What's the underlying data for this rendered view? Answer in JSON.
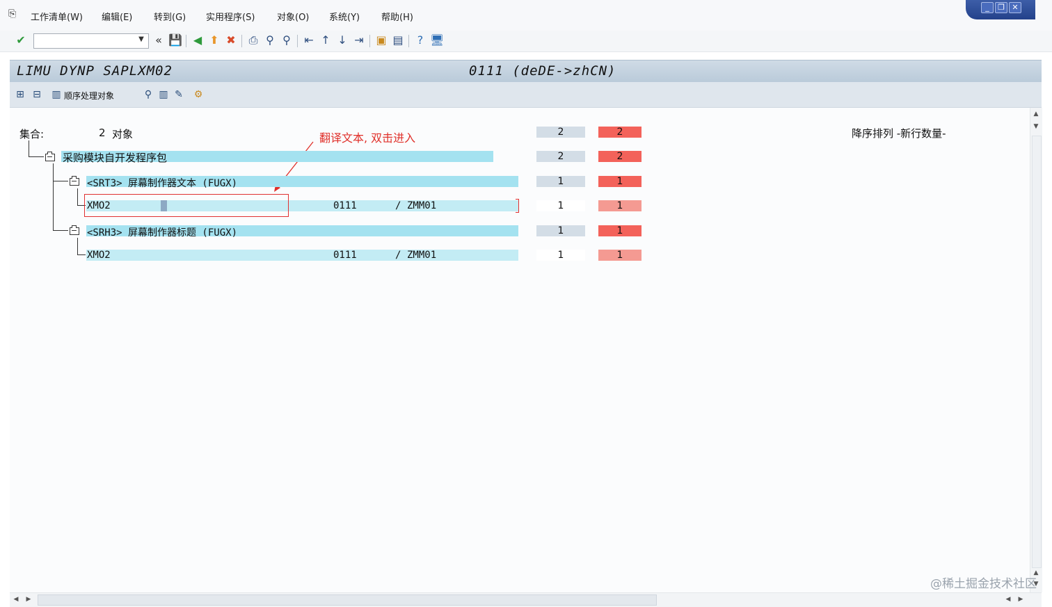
{
  "menu": {
    "items": [
      "工作清单(W)",
      "编辑(E)",
      "转到(G)",
      "实用程序(S)",
      "对象(O)",
      "系统(Y)",
      "帮助(H)"
    ]
  },
  "toolbar": {
    "command_value": "",
    "icons": [
      "enter-icon",
      "save-icon",
      "back-icon",
      "exit-icon",
      "cancel-icon",
      "print-icon",
      "find-icon",
      "find-next-icon",
      "first-page-icon",
      "prev-page-icon",
      "next-page-icon",
      "last-page-icon",
      "new-session-icon",
      "shortcut-icon",
      "help-icon",
      "customize-icon"
    ]
  },
  "title": {
    "left": "LIMU DYNP SAPLXM02",
    "right": "0111 (deDE->zhCN)"
  },
  "app_toolbar": {
    "sequential_label": "顺序处理对象"
  },
  "tree": {
    "set_label": "集合:",
    "set_count": "2",
    "set_objects": "对象",
    "set_num1": "2",
    "set_num2": "2",
    "sort_label": "降序排列 -新行数量-",
    "annotation": "翻译文本, 双击进入",
    "package": {
      "label": "采购模块自开发程序包",
      "num1": "2",
      "num2": "2"
    },
    "groups": [
      {
        "label": "<SRT3> 屏幕制作器文本 (FUGX)",
        "num1": "1",
        "num2": "1",
        "item": {
          "name": "XMO2",
          "dynpro": "0111",
          "sep": "/",
          "target": "ZMM01",
          "num1": "1",
          "num2": "1"
        }
      },
      {
        "label": "<SRH3> 屏幕制作器标题 (FUGX)",
        "num1": "1",
        "num2": "1",
        "item": {
          "name": "XMO2",
          "dynpro": "0111",
          "sep": "/",
          "target": "ZMM01",
          "num1": "1",
          "num2": "1"
        }
      }
    ]
  },
  "watermark": "@稀土掘金技术社区"
}
